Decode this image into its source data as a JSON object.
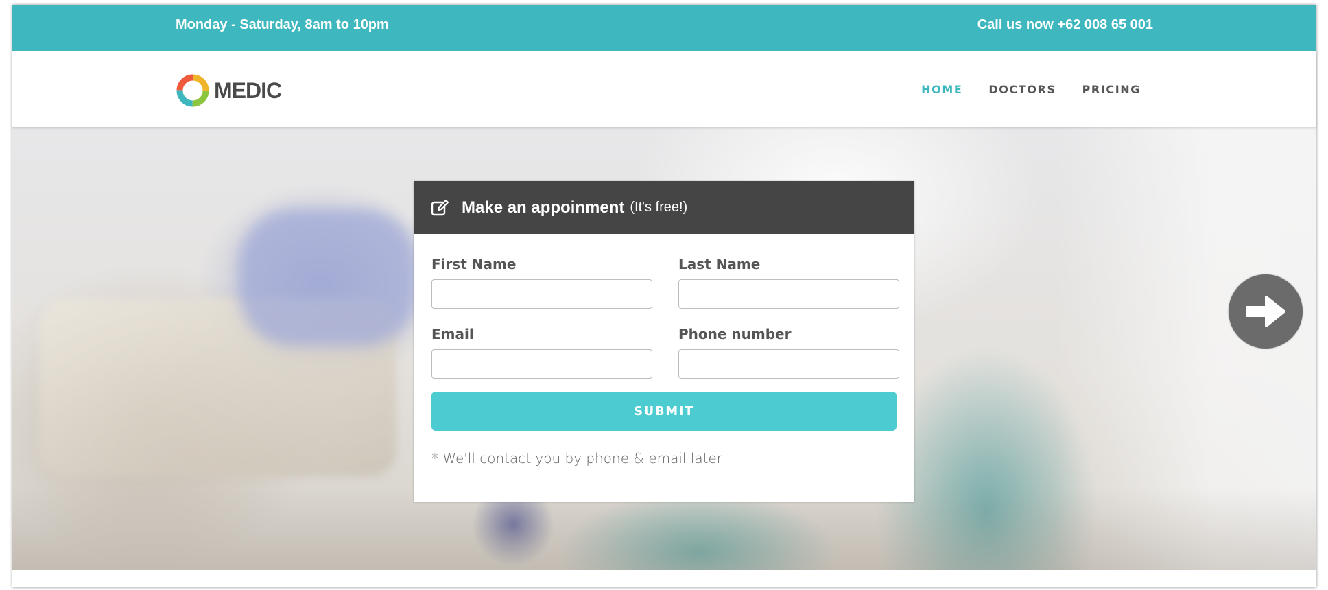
{
  "topbar": {
    "hours": "Monday - Saturday, 8am to 10pm",
    "phone": "Call us now +62 008 65 001"
  },
  "brand": {
    "name": "MEDIC",
    "logo_icon": "ring-logo-icon"
  },
  "nav": {
    "items": [
      {
        "label": "HOME",
        "active": true
      },
      {
        "label": "DOCTORS",
        "active": false
      },
      {
        "label": "PRICING",
        "active": false
      }
    ]
  },
  "appointment": {
    "icon": "edit-icon",
    "title": "Make an appoinment",
    "subtitle": "(It's free!)",
    "fields": {
      "first_name": {
        "label": "First Name",
        "value": "",
        "placeholder": ""
      },
      "last_name": {
        "label": "Last Name",
        "value": "",
        "placeholder": ""
      },
      "email": {
        "label": "Email",
        "value": "",
        "placeholder": ""
      },
      "phone": {
        "label": "Phone number",
        "value": "",
        "placeholder": ""
      }
    },
    "submit_label": "SUBMIT",
    "note": "* We'll contact you by phone & email later"
  },
  "slider": {
    "next_icon": "arrow-right-icon"
  },
  "colors": {
    "accent": "#3eb8be",
    "button": "#4ccbd0",
    "card_header": "#454545"
  }
}
